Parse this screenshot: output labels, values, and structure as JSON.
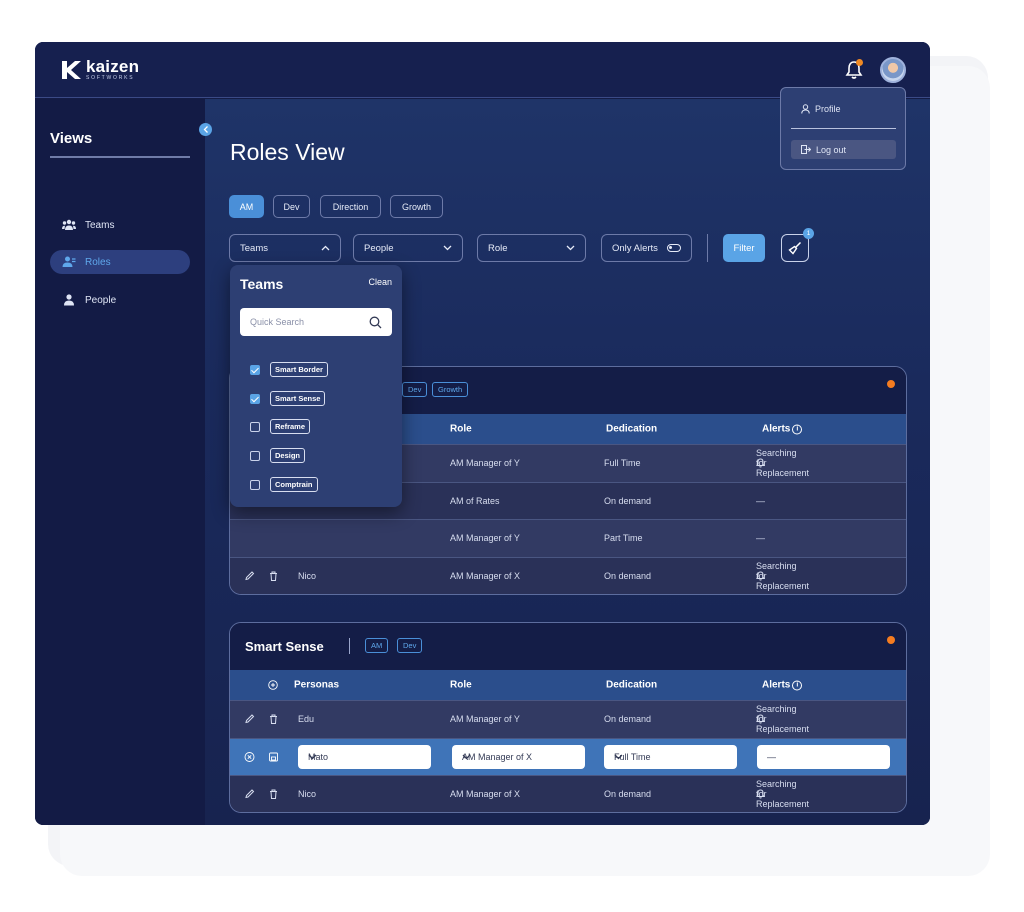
{
  "brand": {
    "name": "kaizen",
    "sub": "SOFTWORKS"
  },
  "sidebar": {
    "title": "Views",
    "items": [
      {
        "label": "Teams",
        "active": false
      },
      {
        "label": "Roles",
        "active": true
      },
      {
        "label": "People",
        "active": false
      }
    ]
  },
  "main": {
    "title": "Roles View",
    "chips": [
      "AM",
      "Dev",
      "Direction",
      "Growth"
    ],
    "filters": {
      "teams": "Teams",
      "people": "People",
      "role": "Role",
      "only_alerts": "Only Alerts",
      "filter_button": "Filter",
      "clear_badge": "1"
    }
  },
  "teams_popup": {
    "title": "Teams",
    "clean": "Clean",
    "search_placeholder": "Quick Search",
    "options": [
      {
        "label": "Smart Border",
        "checked": true
      },
      {
        "label": "Smart Sense",
        "checked": true
      },
      {
        "label": "Reframe",
        "checked": false
      },
      {
        "label": "Design",
        "checked": false
      },
      {
        "label": "Comptrain",
        "checked": false
      }
    ]
  },
  "profile_menu": {
    "profile": "Profile",
    "logout": "Log out"
  },
  "table_columns": {
    "personas": "Personas",
    "role": "Role",
    "dedication": "Dedication",
    "alerts": "Alerts"
  },
  "card1": {
    "chips": [
      "Dev",
      "Growth"
    ],
    "rows": [
      {
        "name": "",
        "role": "AM Manager of Y",
        "dedication": "Full Time",
        "alert": "Searching for Replacement"
      },
      {
        "name": "",
        "role": "AM of Rates",
        "dedication": "On demand",
        "alert": "—"
      },
      {
        "name": "",
        "role": "AM Manager of Y",
        "dedication": "Part Time",
        "alert": "—"
      },
      {
        "name": "Nico",
        "role": "AM Manager of X",
        "dedication": "On demand",
        "alert": "Searching for Replacement"
      }
    ]
  },
  "card2": {
    "title": "Smart Sense",
    "chips": [
      "AM",
      "Dev"
    ],
    "rows": [
      {
        "name": "Edu",
        "role": "AM Manager of Y",
        "dedication": "On demand",
        "alert": "Searching for Replacement"
      },
      {
        "name": "Mato",
        "role": "AM Manager of X",
        "dedication": "Full Time",
        "alert": "—"
      },
      {
        "name": "Nico",
        "role": "AM Manager of X",
        "dedication": "On demand",
        "alert": "Searching for Replacement"
      }
    ]
  },
  "colors": {
    "accent": "#5aa4e6",
    "header_blue": "#2b4e8c",
    "alert_dot": "#f57c20",
    "bg_dark": "#141c45"
  }
}
